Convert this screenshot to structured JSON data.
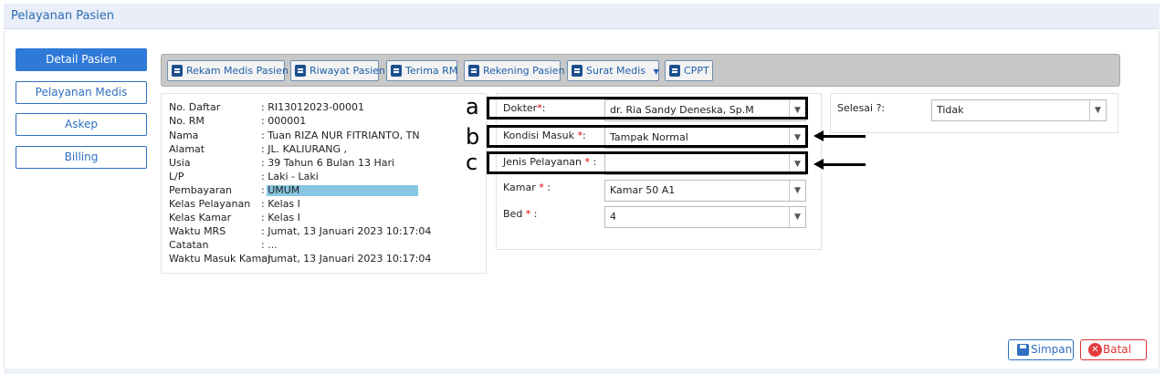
{
  "header": {
    "title": "Pelayanan Pasien"
  },
  "sidebar": {
    "items": [
      {
        "label": "Detail Pasien",
        "active": true
      },
      {
        "label": "Pelayanan Medis"
      },
      {
        "label": "Askep"
      },
      {
        "label": "Billing"
      }
    ]
  },
  "toolbar": {
    "buttons": [
      {
        "label": "Rekam Medis Pasien",
        "icon": "clipboard-icon"
      },
      {
        "label": "Riwayat Pasien",
        "icon": "history-icon"
      },
      {
        "label": "Terima RM",
        "icon": "receive-icon"
      },
      {
        "label": "Rekening Pasien",
        "icon": "wallet-icon"
      },
      {
        "label": "Surat Medis",
        "icon": "document-icon",
        "dropdown": true
      },
      {
        "label": "CPPT",
        "icon": "notes-icon"
      }
    ]
  },
  "patient": {
    "rows": [
      {
        "label": "No. Daftar",
        "value": ": RI13012023-00001"
      },
      {
        "label": "No. RM",
        "value": ": 000001"
      },
      {
        "label": "Nama",
        "value": ": Tuan RIZA NUR FITRIANTO, TN"
      },
      {
        "label": "Alamat",
        "value": ": JL. KALIURANG ,"
      },
      {
        "label": "Usia",
        "value": ": 39 Tahun 6 Bulan 13 Hari"
      },
      {
        "label": "L/P",
        "value": ": Laki - Laki"
      },
      {
        "label": "Pembayaran",
        "value": ": UMUM"
      },
      {
        "label": "Kelas Pelayanan",
        "value": ": Kelas I"
      },
      {
        "label": "Kelas Kamar",
        "value": ": Kelas I"
      },
      {
        "label": "Waktu MRS",
        "value": ": Jumat, 13 Januari 2023 10:17:04"
      },
      {
        "label": "Catatan",
        "value": ": ..."
      },
      {
        "label": "Waktu Masuk Kamar",
        "value": ": Jumat, 13 Januari 2023 10:17:04"
      }
    ]
  },
  "form": {
    "dokter": {
      "label": "Dokter",
      "value": "dr. Ria Sandy Deneska, Sp.M"
    },
    "kondisi": {
      "label": "Kondisi Masuk ",
      "value": "Tampak Normal"
    },
    "jenis": {
      "label": "Jenis Pelayanan ",
      "value": ""
    },
    "kamar": {
      "label": "Kamar ",
      "value": "Kamar 50 A1"
    },
    "bed": {
      "label": "Bed ",
      "value": "4"
    },
    "selesai": {
      "label": "Selesai ?:",
      "value": "Tidak"
    }
  },
  "annotations": {
    "a": "a",
    "b": "b",
    "c": "c"
  },
  "footer": {
    "save": "Simpan",
    "cancel": "Batal"
  },
  "colors": {
    "accent": "#2f7ad8",
    "danger": "#d33333",
    "highlight": "#87c7e2"
  }
}
